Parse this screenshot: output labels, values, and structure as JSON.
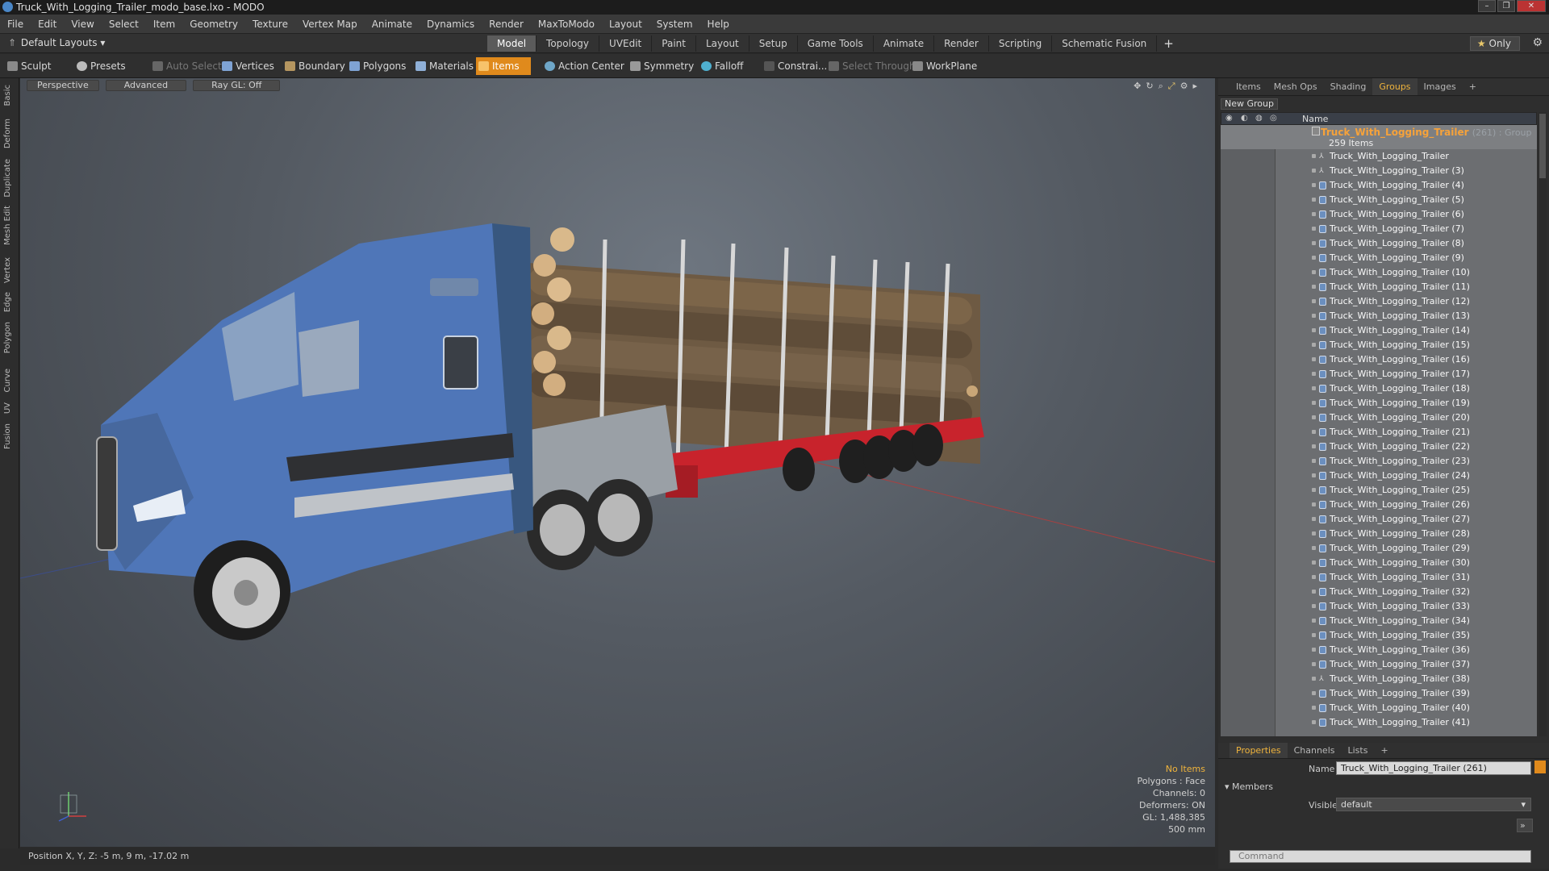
{
  "window": {
    "title": "Truck_With_Logging_Trailer_modo_base.lxo - MODO"
  },
  "menu": [
    "File",
    "Edit",
    "View",
    "Select",
    "Item",
    "Geometry",
    "Texture",
    "Vertex Map",
    "Animate",
    "Dynamics",
    "Render",
    "MaxToModo",
    "Layout",
    "System",
    "Help"
  ],
  "layout": {
    "dropdown": "Default Layouts",
    "tabs": [
      "Model",
      "Topology",
      "UVEdit",
      "Paint",
      "Layout",
      "Setup",
      "Game Tools",
      "Animate",
      "Render",
      "Scripting",
      "Schematic Fusion"
    ],
    "active_tab": "Model",
    "only_label": "Only"
  },
  "toolbar": {
    "sculpt": "Sculpt",
    "presets": "Presets",
    "auto_select": "Auto Select",
    "vertices": "Vertices",
    "boundary": "Boundary",
    "polygons": "Polygons",
    "materials": "Materials",
    "items": "Items",
    "action_center": "Action Center",
    "symmetry": "Symmetry",
    "falloff": "Falloff",
    "constraints": "Constrai...",
    "select_through": "Select Through",
    "workplane": "WorkPlane"
  },
  "left_tabs": [
    "Basic",
    "Deform",
    "Duplicate",
    "Mesh Edit",
    "Vertex",
    "Edge",
    "Polygon",
    "Curve",
    "UV",
    "Fusion"
  ],
  "viewport": {
    "view": "Perspective",
    "shading": "Advanced",
    "raygl": "Ray GL: Off",
    "info": {
      "selection": "No Items",
      "polygons": "Polygons : Face",
      "channels": "Channels: 0",
      "deformers": "Deformers: ON",
      "gl": "GL: 1,488,385",
      "scale": "500 mm"
    }
  },
  "statusbar": {
    "position": "Position X, Y, Z:  -5 m, 9 m, -17.02 m"
  },
  "right_panel": {
    "tabs": [
      "Items",
      "Mesh Ops",
      "Shading",
      "Groups",
      "Images"
    ],
    "active_tab": "Groups",
    "new_group": "New Group",
    "column_name": "Name",
    "group": {
      "name": "Truck_With_Logging_Trailer",
      "count": "(261) : Group",
      "items": "259 Items"
    },
    "items": [
      "Truck_With_Logging_Trailer",
      "Truck_With_Logging_Trailer (3)",
      "Truck_With_Logging_Trailer (4)",
      "Truck_With_Logging_Trailer (5)",
      "Truck_With_Logging_Trailer (6)",
      "Truck_With_Logging_Trailer (7)",
      "Truck_With_Logging_Trailer (8)",
      "Truck_With_Logging_Trailer (9)",
      "Truck_With_Logging_Trailer (10)",
      "Truck_With_Logging_Trailer (11)",
      "Truck_With_Logging_Trailer (12)",
      "Truck_With_Logging_Trailer (13)",
      "Truck_With_Logging_Trailer (14)",
      "Truck_With_Logging_Trailer (15)",
      "Truck_With_Logging_Trailer (16)",
      "Truck_With_Logging_Trailer (17)",
      "Truck_With_Logging_Trailer (18)",
      "Truck_With_Logging_Trailer (19)",
      "Truck_With_Logging_Trailer (20)",
      "Truck_With_Logging_Trailer (21)",
      "Truck_With_Logging_Trailer (22)",
      "Truck_With_Logging_Trailer (23)",
      "Truck_With_Logging_Trailer (24)",
      "Truck_With_Logging_Trailer (25)",
      "Truck_With_Logging_Trailer (26)",
      "Truck_With_Logging_Trailer (27)",
      "Truck_With_Logging_Trailer (28)",
      "Truck_With_Logging_Trailer (29)",
      "Truck_With_Logging_Trailer (30)",
      "Truck_With_Logging_Trailer (31)",
      "Truck_With_Logging_Trailer (32)",
      "Truck_With_Logging_Trailer (33)",
      "Truck_With_Logging_Trailer (34)",
      "Truck_With_Logging_Trailer (35)",
      "Truck_With_Logging_Trailer (36)",
      "Truck_With_Logging_Trailer (37)",
      "Truck_With_Logging_Trailer (38)",
      "Truck_With_Logging_Trailer (39)",
      "Truck_With_Logging_Trailer (40)",
      "Truck_With_Logging_Trailer (41)"
    ],
    "locator_items": [
      0,
      1,
      36
    ],
    "properties": {
      "tabs": [
        "Properties",
        "Channels",
        "Lists"
      ],
      "name_label": "Name",
      "name_value": "Truck_With_Logging_Trailer (261)",
      "members": "Members",
      "visible_label": "Visible",
      "visible_value": "default"
    },
    "command_placeholder": "Command"
  },
  "colors": {
    "accent": "#e08a1c",
    "group_name": "#f6a23a",
    "truck_blue": "#4f76b8",
    "trailer_red": "#c8232c"
  }
}
